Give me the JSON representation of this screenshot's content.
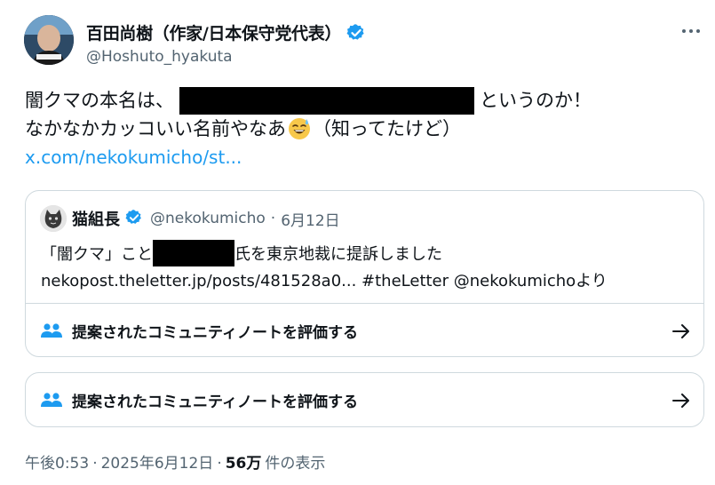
{
  "author": {
    "display_name": "百田尚樹（作家/日本保守党代表）",
    "handle": "@Hoshuto_hyakuta"
  },
  "tweet": {
    "line1_before": "闇クマの本名は、",
    "line1_after": "というのか！",
    "line2_before": "なかなかカッコいい名前やなあ",
    "line2_after": "（知ってたけど）",
    "link": "x.com/nekokumicho/st..."
  },
  "quote": {
    "name": "猫組長",
    "handle": "@nekokumicho",
    "separator": "·",
    "date": "6月12日",
    "text_before": "「闇クマ」こと",
    "text_after": "氏を東京地裁に提訴しました",
    "link_line": "nekopost.theletter.jp/posts/481528a0... #theLetter @nekokumichoより",
    "community_note": "提案されたコミュニティノートを評価する"
  },
  "community_note": "提案されたコミュニティノートを評価する",
  "footer": {
    "time": "午後0:53",
    "sep1": "·",
    "date": "2025年6月12日",
    "sep2": "·",
    "views": "56万",
    "views_label": "件の表示"
  },
  "colors": {
    "link": "#1d9bf0",
    "verified": "#1d9bf0",
    "secondary_text": "#536471",
    "border": "#cfd9de"
  },
  "icons": [
    "verified-badge-icon",
    "more-icon",
    "smiling-sweat-emoji-icon",
    "people-icon",
    "arrow-right-icon"
  ]
}
